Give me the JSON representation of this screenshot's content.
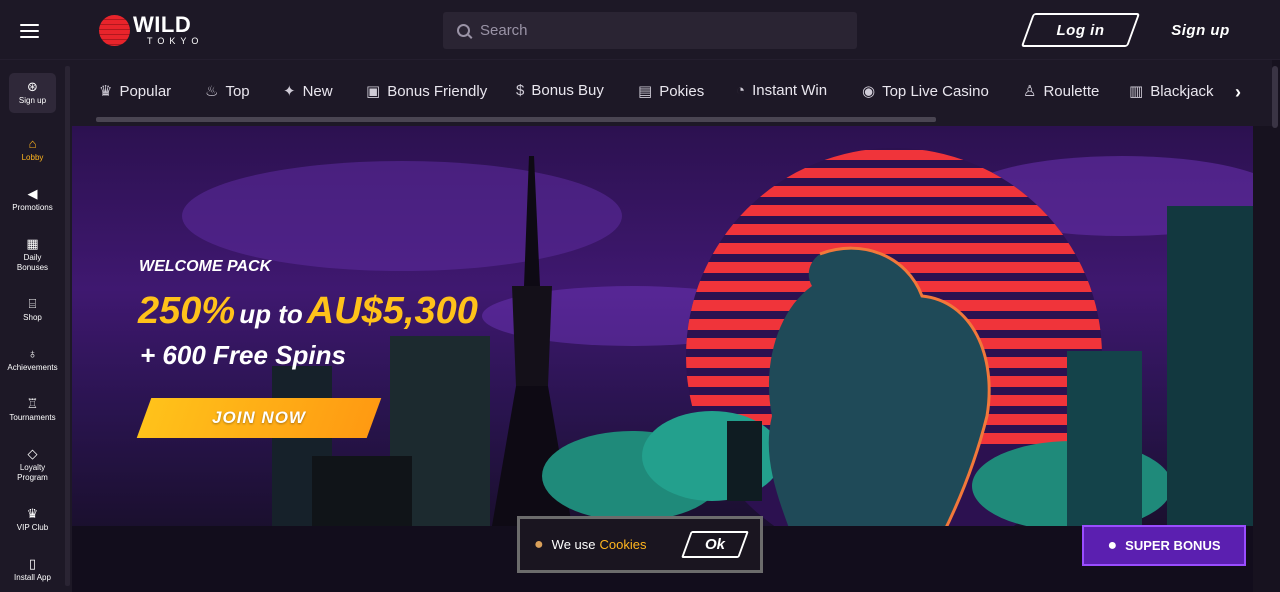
{
  "header": {
    "logo_top": "WILD",
    "logo_bottom": "TOKYO",
    "search_placeholder": "Search",
    "login_label": "Log in",
    "signup_label": "Sign up"
  },
  "sidebar": {
    "items": [
      {
        "label": "Sign up",
        "icon": "gift-icon"
      },
      {
        "label": "Lobby",
        "icon": "home-icon"
      },
      {
        "label": "Promotions",
        "icon": "megaphone-icon"
      },
      {
        "label": "Daily Bonuses",
        "icon": "calendar-star-icon"
      },
      {
        "label": "Shop",
        "icon": "shop-icon"
      },
      {
        "label": "Achievements",
        "icon": "medal-icon"
      },
      {
        "label": "Tournaments",
        "icon": "trophy-icon"
      },
      {
        "label": "Loyalty Program",
        "icon": "diamond-icon"
      },
      {
        "label": "VIP Club",
        "icon": "crown-icon"
      },
      {
        "label": "Install App",
        "icon": "phone-icon"
      }
    ]
  },
  "categories": [
    {
      "label": "Popular",
      "icon": "crown-icon"
    },
    {
      "label": "Top",
      "icon": "flame-icon"
    },
    {
      "label": "New",
      "icon": "sparkle-bell-icon"
    },
    {
      "label": "Bonus Friendly",
      "icon": "gift-icon"
    },
    {
      "label": "Bonus Buy",
      "icon": "money-bag-icon"
    },
    {
      "label": "Pokies",
      "icon": "slot-machine-icon"
    },
    {
      "label": "Instant Win",
      "icon": "stopwatch-icon"
    },
    {
      "label": "Top Live Casino",
      "icon": "dealer-icon"
    },
    {
      "label": "Roulette",
      "icon": "roulette-icon"
    },
    {
      "label": "Blackjack",
      "icon": "cards-icon"
    }
  ],
  "banner": {
    "welcome": "WELCOME PACK",
    "percent": "250%",
    "up_to": "up to",
    "amount": "AU$5,300",
    "spins": "+ 600 Free Spins",
    "cta": "JOIN NOW"
  },
  "cookie": {
    "text": "We use",
    "link": "Cookies",
    "ok": "Ok"
  },
  "super_bonus": "SUPER BONUS",
  "colors": {
    "accent": "#ffb51e",
    "background": "#17121f",
    "super_bonus": "#5b1fb0"
  }
}
